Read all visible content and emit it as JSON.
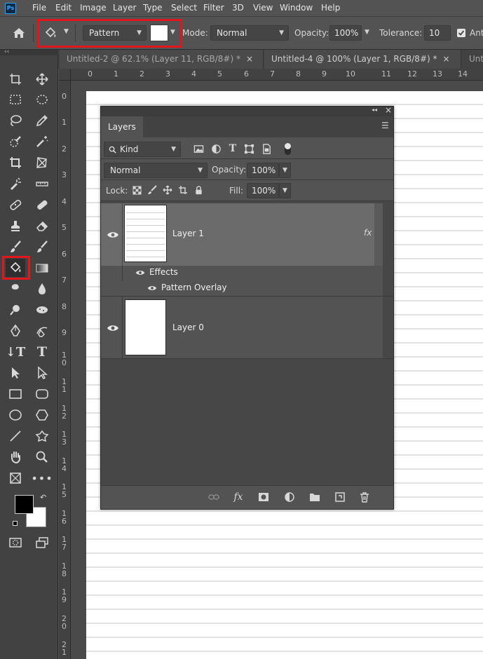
{
  "app": {
    "logo": "Ps"
  },
  "menu": [
    "File",
    "Edit",
    "Image",
    "Layer",
    "Type",
    "Select",
    "Filter",
    "3D",
    "View",
    "Window",
    "Help"
  ],
  "options": {
    "fill_source": "Pattern",
    "mode_label": "Mode:",
    "mode_value": "Normal",
    "opacity_label": "Opacity:",
    "opacity_value": "100%",
    "tolerance_label": "Tolerance:",
    "tolerance_value": "10",
    "antialias_label": "Anti"
  },
  "tabs": [
    {
      "label": "Untitled-2 @ 62.1% (Layer 11, RGB/8#) *",
      "close": "×"
    },
    {
      "label": "Untitled-4 @ 100% (Layer 1, RGB/8#) *",
      "close": "×"
    },
    {
      "label": "Unt"
    }
  ],
  "ruler_h": [
    "0",
    "1",
    "2",
    "3",
    "4",
    "5",
    "6",
    "7",
    "8",
    "9",
    "10",
    "11",
    "12",
    "13",
    "14"
  ],
  "ruler_v": [
    "0",
    "1",
    "2",
    "3",
    "4",
    "5",
    "6",
    "7",
    "8",
    "9",
    "1 0",
    "1 1",
    "1 2",
    "1 3",
    "1 4",
    "1 5",
    "1 6",
    "1 7",
    "1 8",
    "1 9",
    "2 0",
    "2 1"
  ],
  "layers_panel": {
    "collapse_glyph": "◂◂",
    "close_glyph": "×",
    "title": "Layers",
    "filter_label": "Kind",
    "blend_mode": "Normal",
    "opacity_label": "Opacity:",
    "opacity_value": "100%",
    "lock_label": "Lock:",
    "fill_label": "Fill:",
    "fill_value": "100%",
    "layers": [
      {
        "name": "Layer 1",
        "fx": "fx",
        "effects_label": "Effects",
        "effect": "Pattern Overlay"
      },
      {
        "name": "Layer 0"
      }
    ]
  },
  "colors": {
    "highlight": "#e0181e",
    "foreground": "#000000",
    "background": "#ffffff"
  }
}
